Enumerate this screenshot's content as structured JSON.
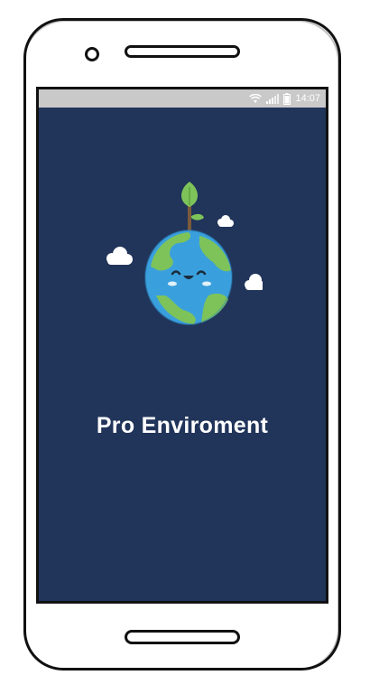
{
  "status_bar": {
    "time": "14:07",
    "icons": [
      "wifi-icon",
      "signal-icon",
      "battery-icon"
    ]
  },
  "app": {
    "title": "Pro Enviroment",
    "logo": "earth-with-sprout-icon"
  },
  "colors": {
    "screen_background": "#21345a",
    "status_bar": "#c9c9c9",
    "title_text": "#ffffff",
    "earth_ocean": "#3aa0dd",
    "earth_land": "#7dc35a",
    "sprout": "#7dc35a"
  }
}
